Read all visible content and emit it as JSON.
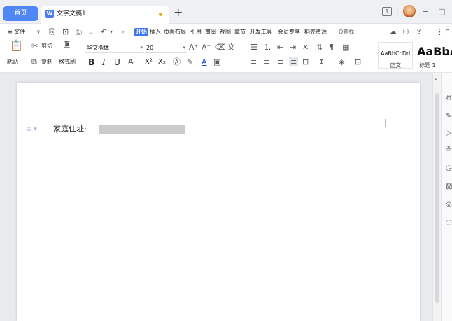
{
  "titlebar": {
    "home_tab": "首页",
    "doc_icon": "W",
    "doc_title": "文字文稿1",
    "add_tab": "+",
    "page_count": "1",
    "minimize": "−",
    "maximize": "□"
  },
  "menubar": {
    "file_menu": "≡ 文件",
    "items": [
      "开始",
      "插入",
      "页面布局",
      "引用",
      "审阅",
      "视图",
      "章节",
      "开发工具",
      "会员专享",
      "稻壳资源"
    ],
    "search": "Q查找",
    "more": "»"
  },
  "ribbon": {
    "paste": "粘贴",
    "cut": "剪切",
    "copy": "复制",
    "format_painter": "格式刷",
    "font_name": "华文楷体",
    "font_size": "20",
    "bold": "B",
    "italic": "I",
    "underline": "U",
    "superscript": "X²",
    "subscript": "X₂"
  },
  "styles": [
    {
      "preview": "AaBbCcDd",
      "name": "正文"
    },
    {
      "preview": "AaBbA",
      "name": "标题 1"
    }
  ],
  "document": {
    "label": "家庭住址:"
  }
}
